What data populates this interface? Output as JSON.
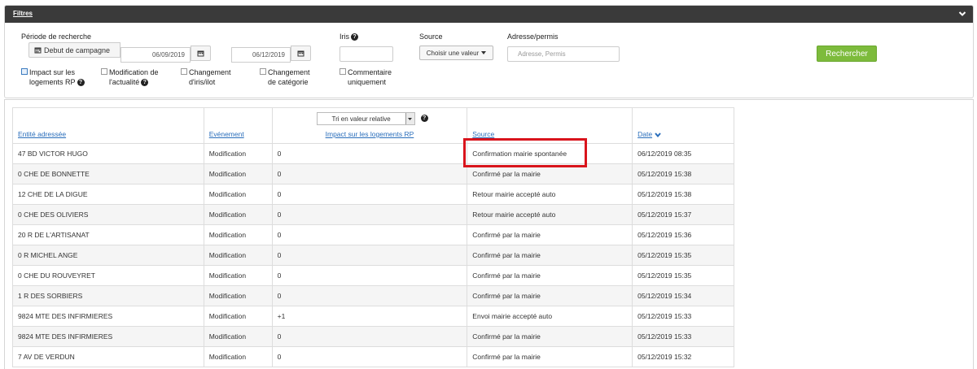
{
  "filters": {
    "title": "Filtres",
    "periode_label": "Période de recherche",
    "period_button": "Debut de campagne",
    "date_start": "06/09/2019",
    "date_end": "06/12/2019",
    "iris_label": "Iris",
    "iris_value": "",
    "source_label": "Source",
    "source_select": "Choisir une valeur",
    "adresse_label": "Adresse/permis",
    "adresse_placeholder": "Adresse, Permis",
    "search_button": "Rechercher",
    "checkboxes": [
      {
        "line1": "Impact sur les",
        "line2": "logements RP",
        "checked": true,
        "help": true
      },
      {
        "line1": "Modification de",
        "line2": "l'actualité",
        "checked": false,
        "help": true
      },
      {
        "line1": "Changement",
        "line2": "d'iris/ilot",
        "checked": false,
        "help": false
      },
      {
        "line1": "Changement",
        "line2": "de catégorie",
        "checked": false,
        "help": false
      },
      {
        "line1": "Commentaire",
        "line2": "uniquement",
        "checked": false,
        "help": false
      }
    ]
  },
  "table": {
    "headers": {
      "entite": "Entité adressée",
      "evenement": "Evénement",
      "impact": "Impact sur les logements RP",
      "source": "Source",
      "date": "Date"
    },
    "sort_select": "Tri en valeur relative",
    "rows": [
      {
        "entite": "47 BD VICTOR HUGO",
        "evenement": "Modification",
        "impact": "0",
        "source": "Confirmation mairie spontanée",
        "date": "06/12/2019 08:35"
      },
      {
        "entite": "0 CHE DE BONNETTE",
        "evenement": "Modification",
        "impact": "0",
        "source": "Confirmé par la mairie",
        "date": "05/12/2019 15:38"
      },
      {
        "entite": "12 CHE DE LA DIGUE",
        "evenement": "Modification",
        "impact": "0",
        "source": "Retour mairie accepté auto",
        "date": "05/12/2019 15:38"
      },
      {
        "entite": "0 CHE DES OLIVIERS",
        "evenement": "Modification",
        "impact": "0",
        "source": "Retour mairie accepté auto",
        "date": "05/12/2019 15:37"
      },
      {
        "entite": "20 R DE L'ARTISANAT",
        "evenement": "Modification",
        "impact": "0",
        "source": "Confirmé par la mairie",
        "date": "05/12/2019 15:36"
      },
      {
        "entite": "0 R MICHEL ANGE",
        "evenement": "Modification",
        "impact": "0",
        "source": "Confirmé par la mairie",
        "date": "05/12/2019 15:35"
      },
      {
        "entite": "0 CHE DU ROUVEYRET",
        "evenement": "Modification",
        "impact": "0",
        "source": "Confirmé par la mairie",
        "date": "05/12/2019 15:35"
      },
      {
        "entite": "1 R DES SORBIERS",
        "evenement": "Modification",
        "impact": "0",
        "source": "Confirmé par la mairie",
        "date": "05/12/2019 15:34"
      },
      {
        "entite": "9824 MTE DES INFIRMIERES",
        "evenement": "Modification",
        "impact": "+1",
        "source": "Envoi mairie accepté auto",
        "date": "05/12/2019 15:33"
      },
      {
        "entite": "9824 MTE DES INFIRMIERES",
        "evenement": "Modification",
        "impact": "0",
        "source": "Confirmé par la mairie",
        "date": "05/12/2019 15:33"
      },
      {
        "entite": "7 AV DE VERDUN",
        "evenement": "Modification",
        "impact": "0",
        "source": "Confirmé par la mairie",
        "date": "05/12/2019 15:32"
      }
    ]
  },
  "colors": {
    "header_bg": "#3a3a3a",
    "search_button": "#7dbb3c",
    "link": "#2a6ebb",
    "highlight": "#d9141c"
  }
}
